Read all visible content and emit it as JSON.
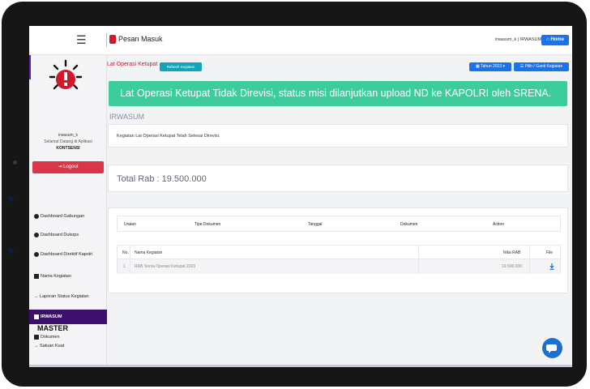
{
  "topbar": {
    "menu_icon": "hamburger-icon",
    "notify_label": "Pesan Masuk",
    "user_label": "irwasum_k | IRWASUM",
    "home_label": "Home"
  },
  "sidebar": {
    "username": "irwasum_k",
    "greeting": "Selamat Datang di Aplikasi",
    "role": "KONTSENSI",
    "logout_label": "Logout",
    "items": [
      {
        "label": "Dashboard Gabungan",
        "icon": "dashboard-icon"
      },
      {
        "label": "Dashboard Dukops",
        "icon": "dashboard-icon"
      },
      {
        "label": "Dashboard Direktif Kapolri",
        "icon": "dashboard-icon"
      },
      {
        "label": "Nama Kegiatan",
        "icon": "list-icon"
      },
      {
        "label": "Laporan Status Kegiatan",
        "icon": "arrow-right-icon"
      },
      {
        "label": "IRWASUM",
        "icon": "document-icon"
      },
      {
        "label": "Dokumen",
        "icon": "folder-icon"
      }
    ],
    "master_label": "MASTER",
    "satuan_label": "Satuan Kuat"
  },
  "subheader": {
    "breadcrumb": "Lat Operasi Ketupat",
    "refresh_label": "Refresh Kegiatan",
    "tahun_label": "Tahun 2023",
    "pilih_label": "Pilih / Ganti Kegiatan"
  },
  "banner": {
    "text": "Lat Operasi Ketupat Tidak Direvisi, status misi dilanjutkan upload ND ke KAPOLRI oleh SRENA."
  },
  "section_title": "IRWASUM",
  "info_text": "Kegiatan Lat Operasi Ketupat Telah Selesai Direvisi.",
  "total_rab": "Total Rab : 19.500.000",
  "doc_table": {
    "headers": [
      "Uraian",
      "Tipe Dokumen",
      "Tanggal",
      "Dokumen",
      "Action"
    ]
  },
  "rab_table": {
    "headers": [
      "No.",
      "Nama Kegiatan",
      "Nilai RAB",
      "File"
    ],
    "rows": [
      {
        "no": "1",
        "nama": "RAB Srena Operasi Ketupat 2023",
        "nilai": "19.500.000"
      }
    ]
  },
  "colors": {
    "brand_red": "#d1192d",
    "primary_blue": "#1a73e8",
    "success_green": "#3dcd9a",
    "active_nav": "#3d0f6c"
  }
}
